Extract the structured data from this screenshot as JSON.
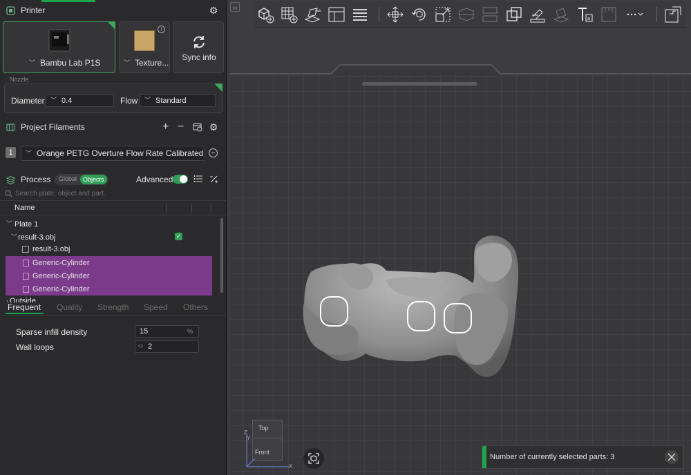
{
  "colors": {
    "accent": "#3fa65e",
    "selection": "#7b3a8a",
    "panel_bg": "#2a2a2c",
    "plate": "#39393c",
    "toast_bar": "#19a64a"
  },
  "printer": {
    "section_title": "Printer",
    "printer_name": "Bambu Lab P1S",
    "plate_type": "Texture...",
    "sync_label": "Sync info",
    "nozzle_label": "Nozzle",
    "diameter_label": "Diameter",
    "diameter_value": "0.4",
    "flow_label": "Flow",
    "flow_value": "Standard"
  },
  "filaments": {
    "section_title": "Project Filaments",
    "items": [
      {
        "index": "1",
        "name": "Orange PETG Overture Flow Rate Calibrated"
      }
    ]
  },
  "process": {
    "section_title": "Process",
    "toggle_global": "Global",
    "toggle_objects": "Objects",
    "advanced_label": "Advanced",
    "search_placeholder": "Search plate, object and part."
  },
  "tree": {
    "column_name": "Name",
    "plate": "Plate 1",
    "object": "result-3.obj",
    "part": "result-3.obj",
    "modifiers": [
      "Generic-Cylinder",
      "Generic-Cylinder",
      "Generic-Cylinder"
    ],
    "outside": "Outside"
  },
  "tabs": [
    "Frequent",
    "Quality",
    "Strength",
    "Speed",
    "Others"
  ],
  "settings": {
    "infill_label": "Sparse infill density",
    "infill_value": "15",
    "infill_unit": "%",
    "wall_label": "Wall loops",
    "wall_value": "2"
  },
  "view_cube": {
    "top": "Top",
    "front": "Front",
    "axis_z": "Z",
    "axis_y": "Y",
    "axis_x": "X"
  },
  "toast": {
    "message": "Number of currently selected parts: 3"
  },
  "toolbar_icons": [
    "add-cube-icon",
    "arrange-grid-icon",
    "auto-orient-icon",
    "split-layout-icon",
    "list-layout-icon",
    "move-icon",
    "rotate-icon",
    "scale-icon",
    "cut-icon",
    "split-icon",
    "boolean-icon",
    "support-paint-icon",
    "seam-paint-icon",
    "text-icon",
    "measure-icon",
    "more-icon",
    "assembly-icon"
  ]
}
